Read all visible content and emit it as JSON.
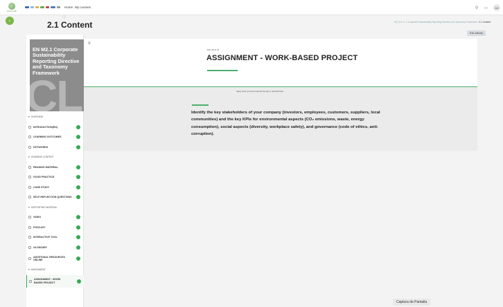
{
  "navbar": {
    "brand_text": "ECO-LAB",
    "nav_home": "Home",
    "nav_courses": "My courses",
    "avatar_initials": "AD"
  },
  "page": {
    "title": "2.1 Content",
    "exit_label": "Exit activity"
  },
  "breadcrumb": {
    "items": [
      "M2_EN",
      "2. 1 Corporate Sustainability Reporting Directive and Taxonomy Framework",
      "2.1 Content"
    ]
  },
  "sidebar": {
    "cover_title": "EN M2.1 Corporate Sustainability Reporting Directive and Taxonomy Framework",
    "cover_big_letters": "CL",
    "sections": [
      {
        "title": "OVERVIEW",
        "items": [
          "INTRODUCTION(EN)",
          "LEARNING OUTCOMES",
          "KEYWORDS"
        ]
      },
      {
        "title": "LEARNING CONTENT",
        "items": [
          "READING MATERIAL",
          "GOOD PRACTICE",
          "CASE STUDY",
          "SELF-REFLECTION QUESTIONS"
        ]
      },
      {
        "title": "SUPPORTING MATERIAL",
        "items": [
          "VIDEO",
          "PODCAST",
          "INTERACTIVE TOOL",
          "GLOSSARY",
          "ADDITIONAL RESOURCES ONLINE"
        ]
      },
      {
        "title": "ASSIGNMENT",
        "items": [
          "ASSIGNMENT - WORK BASED PROJECT"
        ]
      }
    ]
  },
  "content": {
    "part_label": "Part 13 of 13",
    "heading": "ASSIGNMENT - WORK-BASED PROJECT",
    "subtitle": "Apply what you have learned through a practical task.",
    "body": "Identify the key stakeholders of your company (investors, employees, customers, suppliers, local communities) and the key KPIs for environmental aspects (CO₂ emissions, waste, energy consumption), social aspects (diversity, workplace safety), and governance (code of ethics, anti-corruption)."
  },
  "tooltip": {
    "text": "Captura de Pantalla"
  },
  "colors": {
    "accent_green": "#35a855",
    "drawer_green": "#7ab648"
  }
}
